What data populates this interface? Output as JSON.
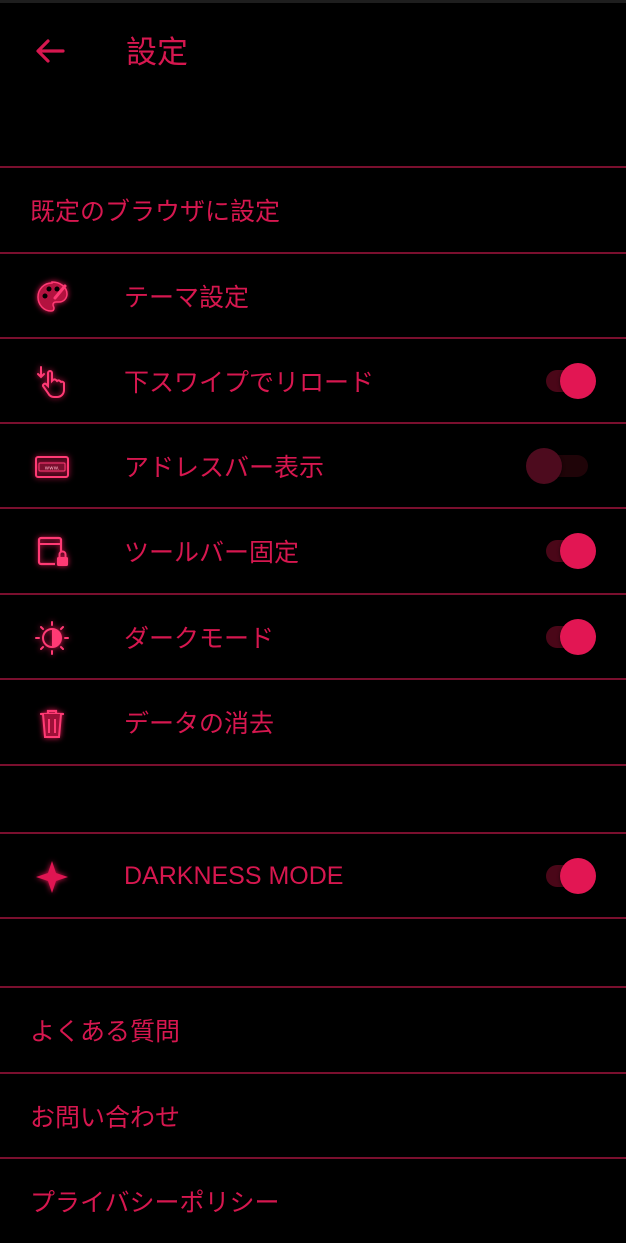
{
  "header": {
    "title": "設定",
    "back_icon": "arrow-left-icon"
  },
  "default_browser": {
    "label": "既定のブラウザに設定"
  },
  "settings": [
    {
      "key": "theme",
      "label": "テーマ設定",
      "icon": "palette-icon"
    },
    {
      "key": "pull_reload",
      "label": "下スワイプでリロード",
      "icon": "swipe-down-hand-icon",
      "toggle": true
    },
    {
      "key": "address_bar",
      "label": "アドレスバー表示",
      "icon": "address-bar-icon",
      "toggle": false
    },
    {
      "key": "toolbar_fixed",
      "label": "ツールバー固定",
      "icon": "phone-lock-icon",
      "toggle": true
    },
    {
      "key": "dark_mode",
      "label": "ダークモード",
      "icon": "brightness-icon",
      "toggle": true
    },
    {
      "key": "clear_data",
      "label": "データの消去",
      "icon": "trash-icon"
    }
  ],
  "darkness": {
    "label": "DARKNESS MODE",
    "icon": "sparkle-icon",
    "toggle": true
  },
  "info": [
    {
      "label": "よくある質問"
    },
    {
      "label": "お問い合わせ"
    },
    {
      "label": "プライバシーポリシー"
    }
  ],
  "colors": {
    "accent": "#d6174f",
    "divider": "#7a0f2e",
    "background": "#000000"
  }
}
